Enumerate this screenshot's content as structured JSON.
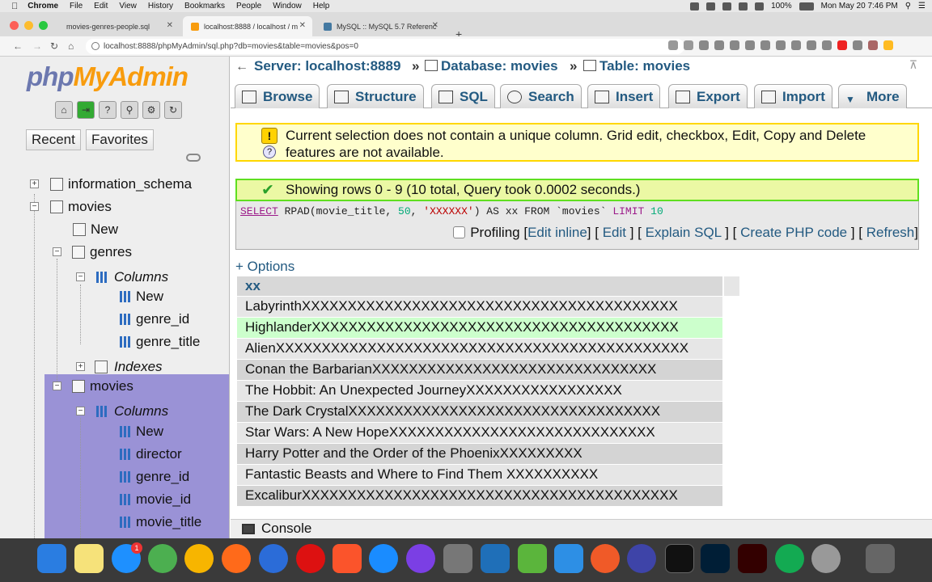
{
  "menubar": {
    "app": "Chrome",
    "items": [
      "File",
      "Edit",
      "View",
      "History",
      "Bookmarks",
      "People",
      "Window",
      "Help"
    ],
    "battery": "100%",
    "clock": "Mon May 20  7:46 PM"
  },
  "browser": {
    "tabs": [
      {
        "label": "movies-genres-people.sql"
      },
      {
        "label": "localhost:8888 / localhost / m"
      },
      {
        "label": "MySQL :: MySQL 5.7 Referenc"
      }
    ],
    "url": "localhost:8888/phpMyAdmin/sql.php?db=movies&table=movies&pos=0"
  },
  "sidebar": {
    "logo_php": "php",
    "logo_ma": "MyAdmin",
    "recent": "Recent",
    "favorites": "Favorites",
    "tree": {
      "info_schema": "information_schema",
      "movies_db": "movies",
      "new_db": "New",
      "genres": "genres",
      "genres_columns": "Columns",
      "genres_new": "New",
      "genre_id": "genre_id",
      "genre_title": "genre_title",
      "genres_indexes": "Indexes",
      "movies_table": "movies",
      "movies_columns": "Columns",
      "movies_new": "New",
      "director": "director",
      "m_genre_id": "genre_id",
      "movie_id": "movie_id",
      "movie_title": "movie_title"
    }
  },
  "breadcrumb": {
    "server": "Server: localhost:8889",
    "database": "Database: movies",
    "table": "Table: movies",
    "sep": "»"
  },
  "tabs": {
    "browse": "Browse",
    "structure": "Structure",
    "sql": "SQL",
    "search": "Search",
    "insert": "Insert",
    "export": "Export",
    "import": "Import",
    "more": "More"
  },
  "notice": {
    "line1": "Current selection does not contain a unique column. Grid edit, checkbox, Edit, Copy and Delete",
    "line2": "features are not available."
  },
  "success": "Showing rows 0 - 9 (10 total, Query took 0.0002 seconds.)",
  "sql": {
    "select": "SELECT",
    "fn": " RPAD(movie_title, ",
    "num1": "50",
    "comma": ", ",
    "str": "'XXXXXX'",
    "rest": ") AS xx FROM `movies` ",
    "limit": "LIMIT",
    "num2": " 10"
  },
  "query_links": {
    "profiling": "Profiling",
    "edit_inline": "Edit inline",
    "edit": "Edit",
    "explain": "Explain SQL",
    "php": "Create PHP code",
    "refresh": "Refresh"
  },
  "options": "+ Options",
  "results": {
    "header": "xx",
    "rows": [
      "LabyrinthXXXXXXXXXXXXXXXXXXXXXXXXXXXXXXXXXXXXXXXXX",
      "HighlanderXXXXXXXXXXXXXXXXXXXXXXXXXXXXXXXXXXXXXXXX",
      "AlienXXXXXXXXXXXXXXXXXXXXXXXXXXXXXXXXXXXXXXXXXXXXX",
      "Conan the BarbarianXXXXXXXXXXXXXXXXXXXXXXXXXXXXXXX",
      "The Hobbit: An Unexpected JourneyXXXXXXXXXXXXXXXXX",
      "The Dark CrystalXXXXXXXXXXXXXXXXXXXXXXXXXXXXXXXXXX",
      "Star Wars: A New HopeXXXXXXXXXXXXXXXXXXXXXXXXXXXXX",
      "Harry Potter and the Order of the PhoenixXXXXXXXXX",
      "Fantastic Beasts and Where to Find Them XXXXXXXXXX",
      "ExcaliburXXXXXXXXXXXXXXXXXXXXXXXXXXXXXXXXXXXXXXXXX"
    ]
  },
  "console": "Console",
  "colors": {
    "accent": "#235a81",
    "warning_bg": "#ffffcc",
    "success_bg": "#ebf8a4",
    "selection": "#9a92d6"
  }
}
